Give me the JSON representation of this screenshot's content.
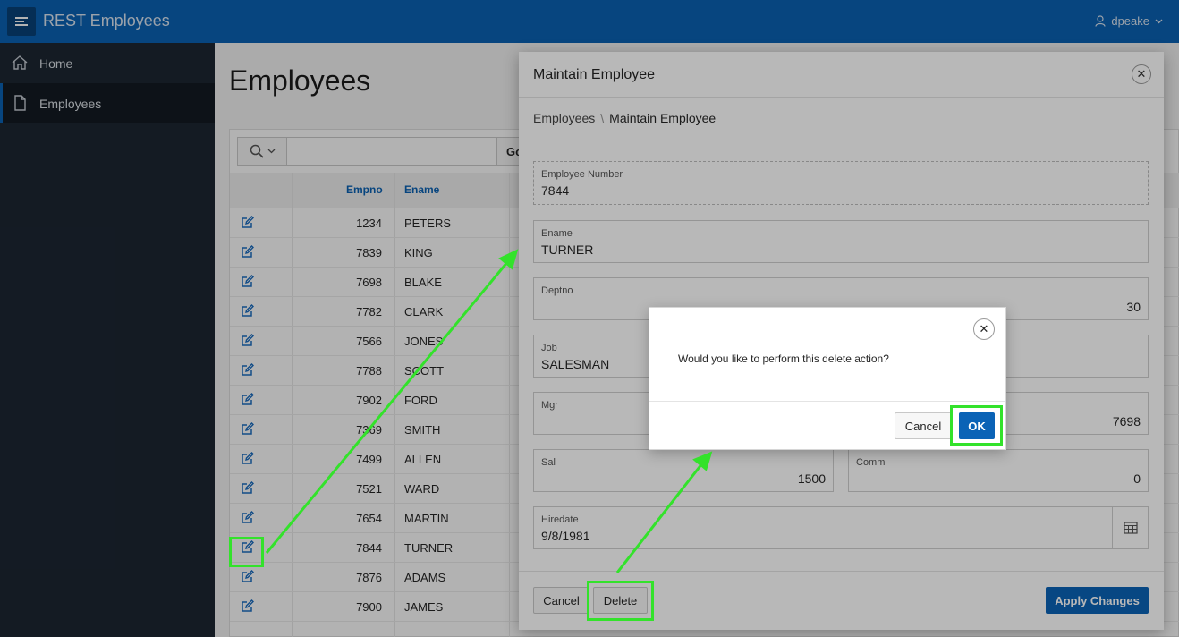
{
  "header": {
    "app_title": "REST Employees",
    "user": "dpeake",
    "color": "#0b63b6"
  },
  "sidebar": {
    "items": [
      {
        "label": "Home",
        "icon": "home-icon"
      },
      {
        "label": "Employees",
        "icon": "document-icon",
        "active": true
      }
    ]
  },
  "page": {
    "title": "Employees",
    "search": {
      "go_label": "Go"
    },
    "columns": {
      "empno": "Empno",
      "ename": "Ename"
    },
    "rows": [
      {
        "empno": "1234",
        "ename": "PETERS"
      },
      {
        "empno": "7839",
        "ename": "KING"
      },
      {
        "empno": "7698",
        "ename": "BLAKE"
      },
      {
        "empno": "7782",
        "ename": "CLARK"
      },
      {
        "empno": "7566",
        "ename": "JONES"
      },
      {
        "empno": "7788",
        "ename": "SCOTT"
      },
      {
        "empno": "7902",
        "ename": "FORD"
      },
      {
        "empno": "7369",
        "ename": "SMITH"
      },
      {
        "empno": "7499",
        "ename": "ALLEN"
      },
      {
        "empno": "7521",
        "ename": "WARD"
      },
      {
        "empno": "7654",
        "ename": "MARTIN"
      },
      {
        "empno": "7844",
        "ename": "TURNER"
      },
      {
        "empno": "7876",
        "ename": "ADAMS"
      },
      {
        "empno": "7900",
        "ename": "JAMES"
      }
    ]
  },
  "dialog": {
    "title": "Maintain Employee",
    "breadcrumb": {
      "parent": "Employees",
      "separator": "\\",
      "current": "Maintain Employee"
    },
    "fields": {
      "employee_number": {
        "label": "Employee Number",
        "value": "7844"
      },
      "ename": {
        "label": "Ename",
        "value": "TURNER"
      },
      "deptno": {
        "label": "Deptno",
        "value": "30"
      },
      "job": {
        "label": "Job",
        "value": "SALESMAN"
      },
      "mgr": {
        "label": "Mgr",
        "value": "7698"
      },
      "sal": {
        "label": "Sal",
        "value": "1500"
      },
      "comm": {
        "label": "Comm",
        "value": "0"
      },
      "hiredate": {
        "label": "Hiredate",
        "value": "9/8/1981"
      }
    },
    "buttons": {
      "cancel": "Cancel",
      "delete": "Delete",
      "apply": "Apply Changes"
    }
  },
  "confirm": {
    "message": "Would you like to perform this delete action?",
    "cancel": "Cancel",
    "ok": "OK"
  },
  "annotation_color": "#33e22b"
}
